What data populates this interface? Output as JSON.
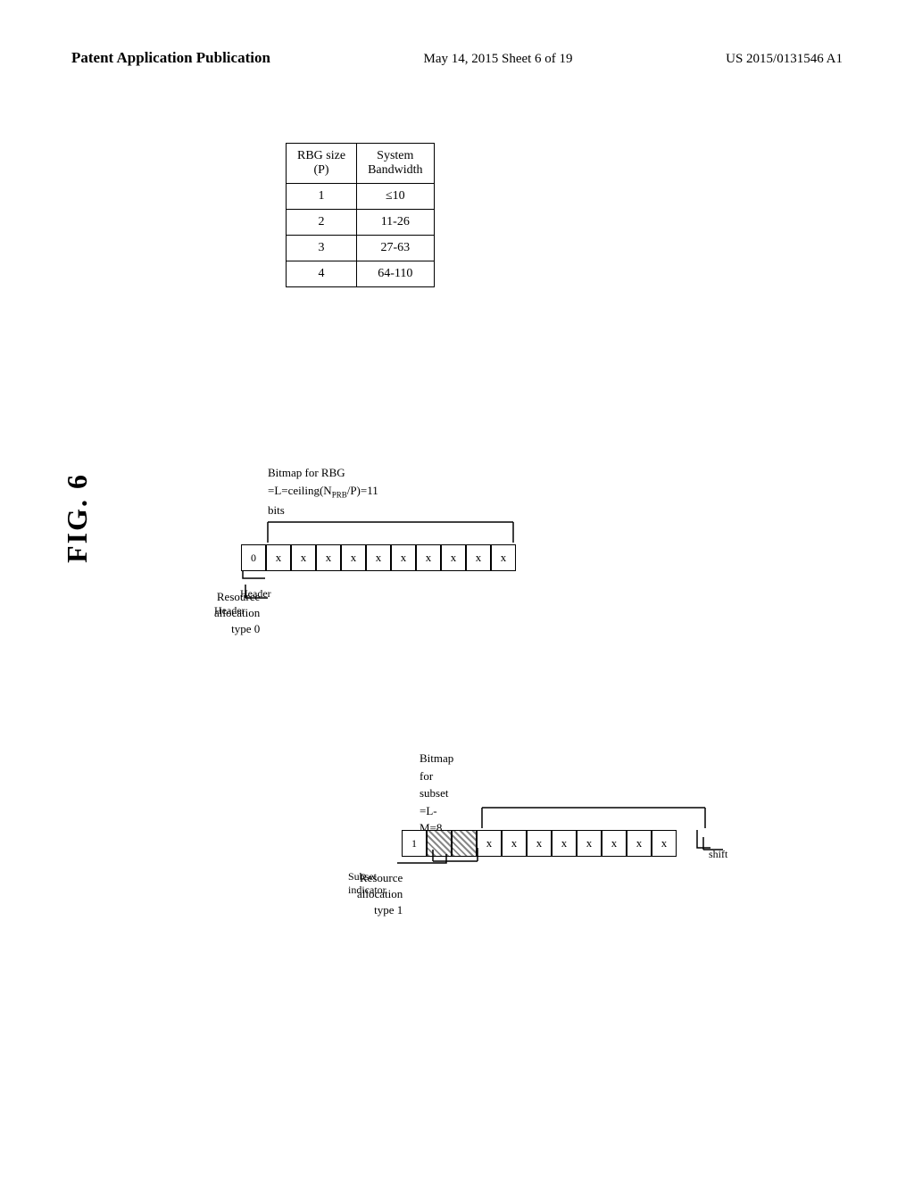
{
  "header": {
    "left": "Patent Application Publication",
    "center": "May 14, 2015   Sheet 6 of 19",
    "right": "US 2015/0131546 A1"
  },
  "table": {
    "col1_header_line1": "RBG size",
    "col1_header_line2": "(P)",
    "col2_header_line1": "System",
    "col2_header_line2": "Bandwidth",
    "rows": [
      {
        "rbg_size": "1",
        "bandwidth": "≤10"
      },
      {
        "rbg_size": "2",
        "bandwidth": "11-26"
      },
      {
        "rbg_size": "3",
        "bandwidth": "27-63"
      },
      {
        "rbg_size": "4",
        "bandwidth": "64-110"
      }
    ]
  },
  "fig_label": "FIG. 6",
  "diagram": {
    "type0": {
      "bitmap_label_line1": "Bitmap for RBG",
      "bitmap_label_line2": "=L=ceiling(N",
      "bitmap_label_subscript": "PRB",
      "bitmap_label_line3": "/P)=11 bits",
      "header_label": "Header",
      "header_value": "0",
      "cells": [
        "x",
        "x",
        "x",
        "x",
        "x",
        "x",
        "x",
        "x",
        "x",
        "x"
      ],
      "ra_label_line1": "Resource",
      "ra_label_line2": "allocation",
      "ra_label_line3": "type 0"
    },
    "type1": {
      "bitmap_label_line1": "Bitmap for subset",
      "bitmap_label_line2": "=L-M=8 bits",
      "subset_indicator_label": "Subset indicator",
      "shift_label": "shift",
      "header_value": "1",
      "cells_hatched": 2,
      "cells_x": [
        "x",
        "x",
        "x",
        "x",
        "x",
        "x",
        "x",
        "x"
      ],
      "ra_label_line1": "Resource",
      "ra_label_line2": "allocation",
      "ra_label_line3": "type 1"
    }
  },
  "icons": {}
}
